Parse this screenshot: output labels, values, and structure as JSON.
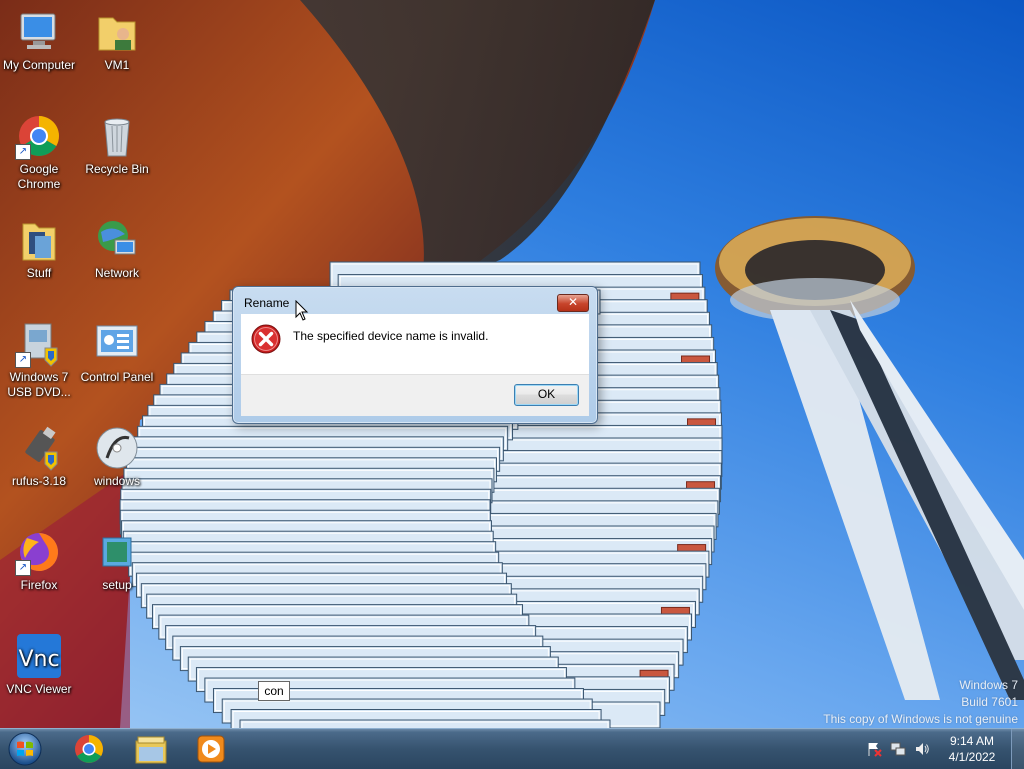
{
  "desktop": {
    "icons": [
      {
        "label": "My Computer"
      },
      {
        "label": "VM1"
      },
      {
        "label": "Google Chrome"
      },
      {
        "label": "Recycle Bin"
      },
      {
        "label": "Stuff"
      },
      {
        "label": "Network"
      },
      {
        "label": "Windows 7 USB DVD..."
      },
      {
        "label": "Control Panel"
      },
      {
        "label": "rufus-3.18"
      },
      {
        "label": "windows"
      },
      {
        "label": "Firefox"
      },
      {
        "label": "setup"
      },
      {
        "label": "VNC Viewer"
      }
    ],
    "rename_text": "con",
    "watermark": {
      "line1": "Windows 7",
      "line2": "Build 7601",
      "line3": "This copy of Windows is not genuine"
    }
  },
  "dialog": {
    "title": "Rename",
    "close_label": "✕",
    "message": "The specified device name is invalid.",
    "ok_label": "OK"
  },
  "taskbar": {
    "time": "9:14 AM",
    "date": "4/1/2022",
    "pinned": [
      "chrome-icon",
      "explorer-icon",
      "media-player-icon"
    ]
  }
}
